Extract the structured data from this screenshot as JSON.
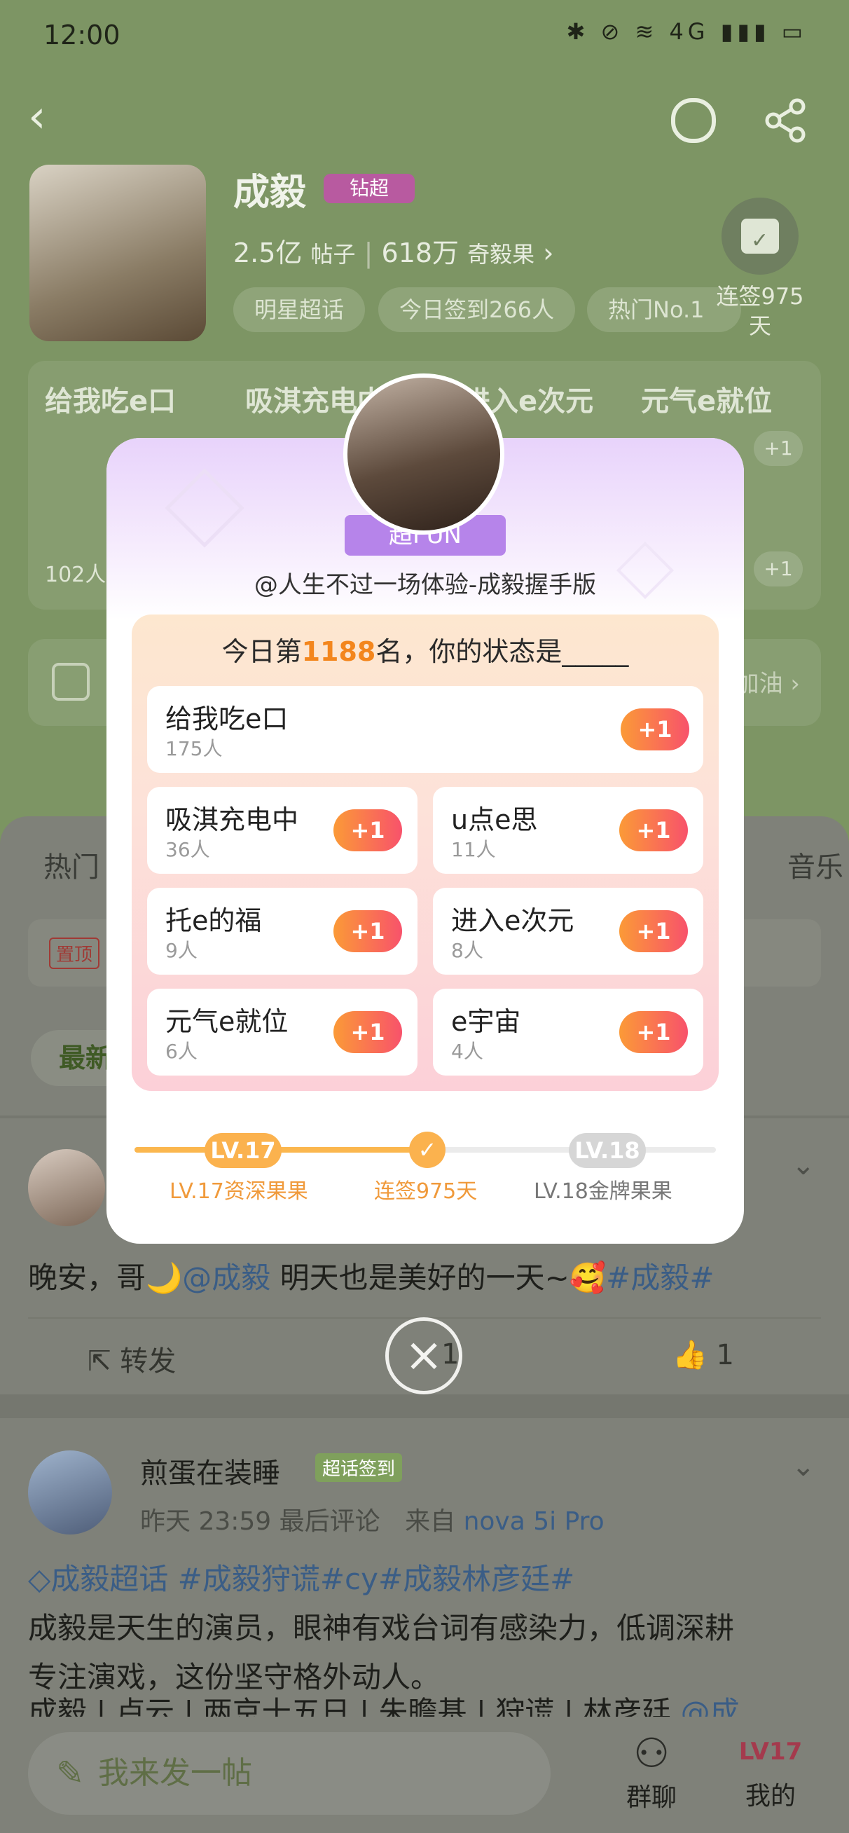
{
  "status_bar": {
    "time": "12:00",
    "right_icons": "✱ ⊘ ≋ 4G ▮▮▮ ▭"
  },
  "header": {
    "back_icon": "‹",
    "search_icon": "○",
    "share_icon": "⋔"
  },
  "profile": {
    "name": "成毅",
    "badge": "钻超",
    "posts_count": "2.5亿",
    "posts_label": "帖子",
    "fans_count": "618万",
    "fans_label": "奇毅果",
    "chips": [
      "明星超话",
      "今日签到266人",
      "热门No.1"
    ],
    "sign_text": "连签975天"
  },
  "bg_status_row": {
    "items": [
      "给我吃e口",
      "吸淇充电中",
      "进入e次元",
      "元气e就位"
    ],
    "plus": "+1",
    "count": "102人"
  },
  "bg_bar2_right": "加油 ›",
  "tabs": {
    "left": "热门",
    "right": "音乐"
  },
  "pin_badge": "置顶",
  "newest_label": "最新",
  "post1": {
    "text_prefix": "晚安，哥🌙",
    "mention": "@成毅",
    "text_mid": " 明天也是美好的一天~🥰",
    "hashtag": "#成毅#",
    "forward_label": "转发",
    "comment_count": "1",
    "like_count": "1"
  },
  "post2": {
    "author": "煎蛋在装睡",
    "badge": "超话签到",
    "time": "昨天 23:59 最后评论",
    "source_prefix": "来自",
    "source": "nova 5i Pro",
    "tags": "成毅超话 #成毅狩谎#cy#成毅林彦廷#",
    "line1": "成毅是天生的演员，眼神有戏台词有感染力，低调深耕",
    "line2": "专注演戏，这份坚守格外动人。",
    "line3": "成毅 | 卢云 | 两京十五日 | 朱瞻基 | 狩谎 | 林彦廷",
    "line3_link": "@成"
  },
  "bottom": {
    "compose": "我来发一帖",
    "group_chat": "群聊",
    "mine": "我的",
    "level_badge": "LV17"
  },
  "modal": {
    "badge": "超FUN",
    "handle": "@人生不过一场体验-成毅握手版",
    "title_prefix": "今日第",
    "rank": "1188",
    "title_suffix": "名，你的状态是_____",
    "plus_label": "+1",
    "options": [
      {
        "label": "给我吃e口",
        "count": "175人"
      },
      {
        "label": "吸淇充电中",
        "count": "36人"
      },
      {
        "label": "u点e思",
        "count": "11人"
      },
      {
        "label": "托e的福",
        "count": "9人"
      },
      {
        "label": "进入e次元",
        "count": "8人"
      },
      {
        "label": "元气e就位",
        "count": "6人"
      },
      {
        "label": "e宇宙",
        "count": "4人"
      }
    ],
    "level_current": "LV.17",
    "level_next": "LV.18",
    "level_current_label": "LV.17资深果果",
    "streak_label": "连签975天",
    "level_next_label": "LV.18金牌果果",
    "progress": 0.5
  },
  "colors": {
    "accent_orange": "#f3861d",
    "plus_gradient_start": "#fb9a37",
    "plus_gradient_end": "#f8526b",
    "purple": "#b684ea"
  }
}
